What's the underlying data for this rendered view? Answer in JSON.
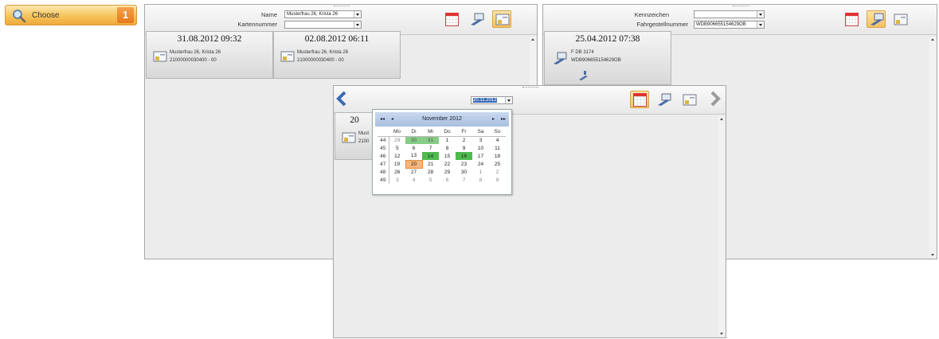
{
  "choose": {
    "label": "Choose",
    "count": "1"
  },
  "panel_left": {
    "fields": {
      "name_label": "Name",
      "name_value": "Musterfrau 26, Krista 26",
      "card_label": "Kartennummer",
      "card_value": ""
    },
    "cards": [
      {
        "datetime": "31.08.2012 09:32",
        "line1": "Musterfrau 26, Krista 26",
        "line2": "21000000030400 - 00"
      },
      {
        "datetime": "02.08.2012 06:11",
        "line1": "Musterfrau 26, Krista 26",
        "line2": "21000000030400 - 00"
      }
    ]
  },
  "panel_right": {
    "fields": {
      "plate_label": "Kennzeichen",
      "plate_value": "",
      "vin_label": "Fahrgestellnummer",
      "vin_value": "WDB906655154629OB"
    },
    "cards": [
      {
        "datetime": "25.04.2012 07:38",
        "line1": "F DB 3174",
        "line2": "WDB906655154629OB"
      }
    ]
  },
  "panel_center": {
    "date_value": "20.11.2012",
    "card_partial": {
      "datetime": "20",
      "line1": "Must",
      "line2": "2100"
    }
  },
  "datepicker": {
    "month": "November 2012",
    "nav": {
      "prev_year": "◂◂",
      "prev_month": "◂",
      "next_month": "▸",
      "next_year": "▸▸"
    },
    "weekdays": [
      "Mo",
      "Di",
      "Mi",
      "Do",
      "Fr",
      "Sa",
      "So"
    ],
    "weeks": [
      {
        "kw": "44",
        "days": [
          "29",
          "30",
          "31",
          "1",
          "2",
          "3",
          "4"
        ]
      },
      {
        "kw": "45",
        "days": [
          "5",
          "6",
          "7",
          "8",
          "9",
          "10",
          "11"
        ]
      },
      {
        "kw": "46",
        "days": [
          "12",
          "13",
          "14",
          "15",
          "16",
          "17",
          "18"
        ]
      },
      {
        "kw": "47",
        "days": [
          "19",
          "20",
          "21",
          "22",
          "23",
          "24",
          "25"
        ]
      },
      {
        "kw": "48",
        "days": [
          "26",
          "27",
          "28",
          "29",
          "30",
          "1",
          "2"
        ]
      },
      {
        "kw": "49",
        "days": [
          "3",
          "4",
          "5",
          "6",
          "7",
          "8",
          "9"
        ]
      }
    ],
    "highlighted_green": [
      "30",
      "31",
      "14",
      "16"
    ],
    "today": "20"
  },
  "colors": {
    "accent_orange": "#f0a93c",
    "highlight_green": "#4dbb4d",
    "today_orange": "#f8b57a",
    "header_blue": "#a9c0df"
  }
}
